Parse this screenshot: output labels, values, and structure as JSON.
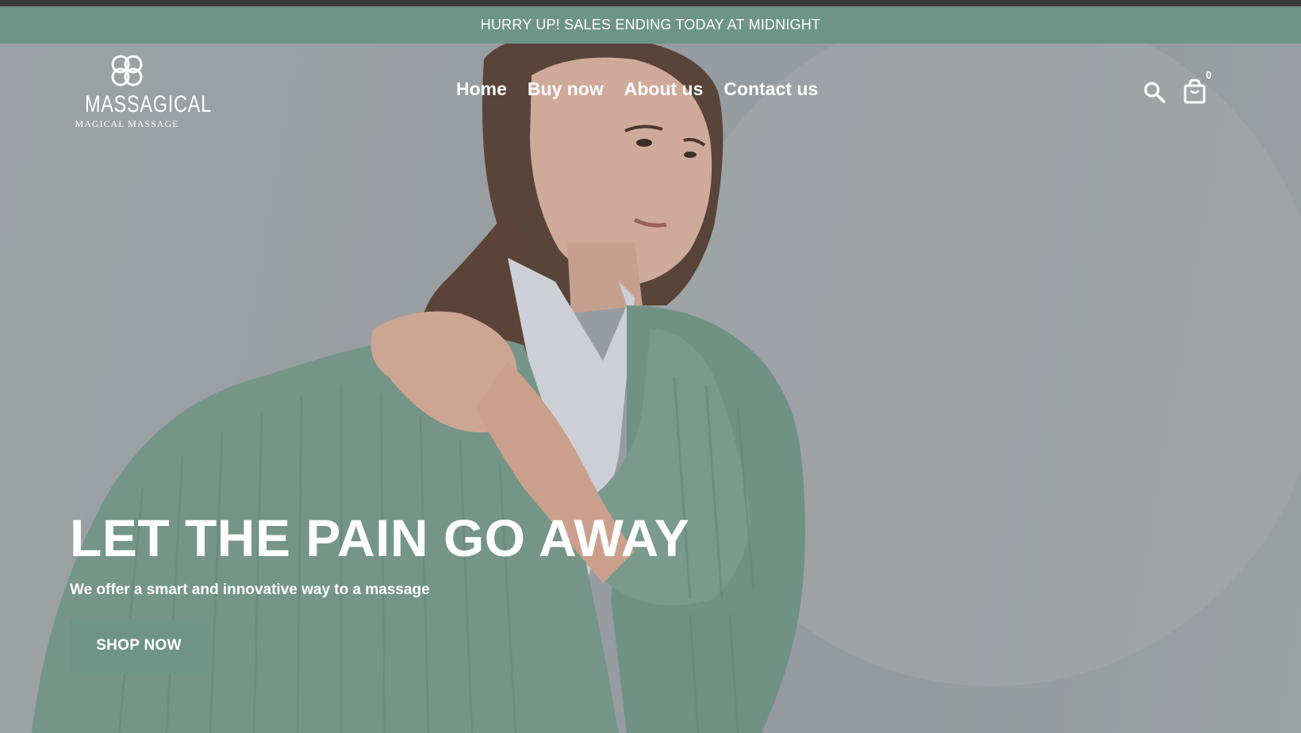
{
  "announcement": {
    "text": "HURRY UP! SALES ENDING TODAY AT MIDNIGHT",
    "background": "#6e9488"
  },
  "header": {
    "logo": {
      "brand": "MASSAGICAL",
      "tagline": "MAGICAL MASSAGE",
      "icon": "clover-logo-icon"
    },
    "nav": [
      {
        "label": "Home"
      },
      {
        "label": "Buy now"
      },
      {
        "label": "About us"
      },
      {
        "label": "Contact us"
      }
    ],
    "icons": {
      "search": "search-icon",
      "cart": "shopping-bag-icon",
      "cart_count": "0"
    }
  },
  "hero": {
    "image": "woman-in-green-cardigan-holding-shoulder",
    "title": "LET THE PAIN GO AWAY",
    "subtitle": "We offer a smart and innovative way to a massage",
    "cta_label": "SHOP NOW",
    "cta_color": "#6e9488"
  }
}
